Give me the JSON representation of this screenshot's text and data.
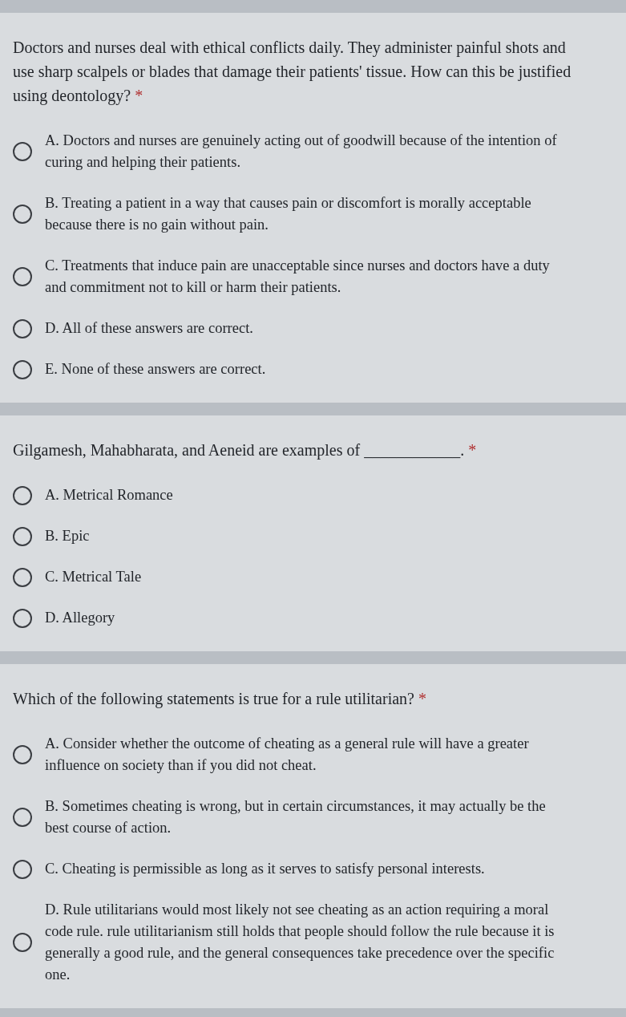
{
  "questions": [
    {
      "text": "Doctors and nurses deal with ethical conflicts daily. They administer painful shots and use sharp scalpels or blades that damage their patients' tissue. How can this be justified using deontology?",
      "required_mark": "*",
      "options": [
        {
          "label": "A. Doctors and nurses are genuinely acting out of goodwill because of the intention of curing and helping their patients.",
          "selected": false
        },
        {
          "label": "B. Treating a patient in a way that causes pain or discomfort is morally acceptable because there is no gain without pain.",
          "selected": false
        },
        {
          "label": "C. Treatments that induce pain are unacceptable since nurses and doctors have a duty and commitment not to kill or harm their patients.",
          "selected": false
        },
        {
          "label": "D. All of these answers are correct.",
          "selected": false
        },
        {
          "label": "E. None of these answers are correct.",
          "selected": false
        }
      ]
    },
    {
      "text": "Gilgamesh, Mahabharata, and Aeneid are examples of ____________.",
      "required_mark": "*",
      "options": [
        {
          "label": "A. Metrical Romance",
          "selected": false
        },
        {
          "label": "B. Epic",
          "selected": false
        },
        {
          "label": "C. Metrical Tale",
          "selected": false
        },
        {
          "label": "D. Allegory",
          "selected": false
        }
      ]
    },
    {
      "text": "Which of the following statements is true for a rule utilitarian?",
      "required_mark": "*",
      "options": [
        {
          "label": "A. Consider whether the outcome of cheating as a general rule will have a greater influence on society than if you did not cheat.",
          "selected": false
        },
        {
          "label": "B. Sometimes cheating is wrong, but in certain circumstances, it may actually be the best course of action.",
          "selected": false
        },
        {
          "label": "C. Cheating is permissible as long as it serves to satisfy personal interests.",
          "selected": false
        },
        {
          "label": "D. Rule utilitarians would most likely not see cheating as an action requiring a moral code rule. rule utilitarianism still holds that people should follow the rule because it is generally a good rule, and the general consequences take precedence over the specific one.",
          "selected": false
        }
      ]
    }
  ]
}
